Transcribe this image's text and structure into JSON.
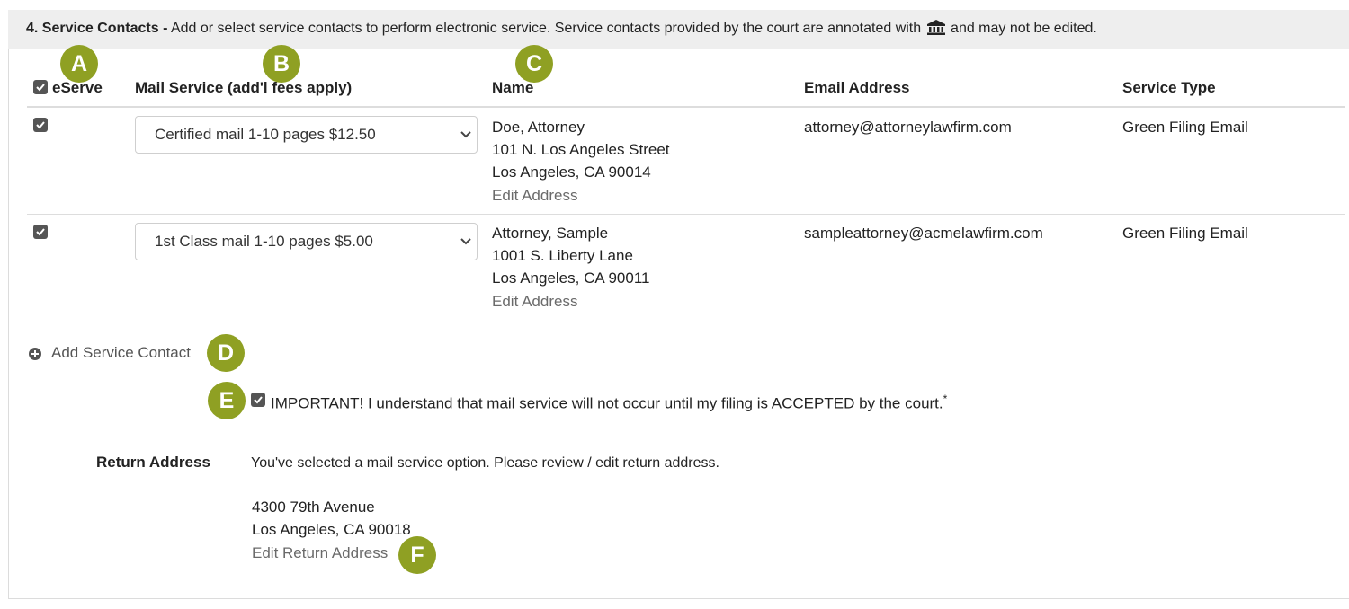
{
  "section": {
    "number_title": "4. Service Contacts -",
    "desc_before_icon": " Add or select service contacts to perform electronic service. Service contacts provided by the court are annotated with ",
    "desc_after_icon": " and may not be edited.",
    "court_icon": "bank-icon"
  },
  "columns": {
    "eserve": "eServe",
    "mail_service": "Mail Service (add'l fees apply)",
    "name": "Name",
    "email": "Email Address",
    "service_type": "Service Type"
  },
  "contacts": [
    {
      "eserve_checked": true,
      "mail_service": "Certified mail 1-10 pages $12.50",
      "name": "Doe, Attorney",
      "address_line1": "101 N. Los Angeles Street",
      "address_line2": "Los Angeles, CA 90014",
      "edit_address": "Edit Address",
      "email": "attorney@attorneylawfirm.com",
      "service_type": "Green Filing Email"
    },
    {
      "eserve_checked": true,
      "mail_service": "1st Class mail 1-10 pages $5.00",
      "name": "Attorney, Sample",
      "address_line1": "1001 S. Liberty Lane",
      "address_line2": "Los Angeles, CA 90011",
      "edit_address": "Edit Address",
      "email": "sampleattorney@acmelawfirm.com",
      "service_type": "Green Filing Email"
    }
  ],
  "add_contact": "Add Service Contact",
  "important": {
    "checked": true,
    "text": "IMPORTANT! I understand that mail service will not occur until my filing is ACCEPTED by the court.",
    "required_mark": "*"
  },
  "return_address": {
    "label": "Return Address",
    "note": "You've selected a mail service option. Please review / edit return address.",
    "line1": "4300 79th Avenue",
    "line2": "Los Angeles, CA 90018",
    "edit": "Edit Return Address"
  },
  "callouts": {
    "a": "A",
    "b": "B",
    "c": "C",
    "d": "D",
    "e": "E",
    "f": "F",
    "color": "#8fa023"
  }
}
